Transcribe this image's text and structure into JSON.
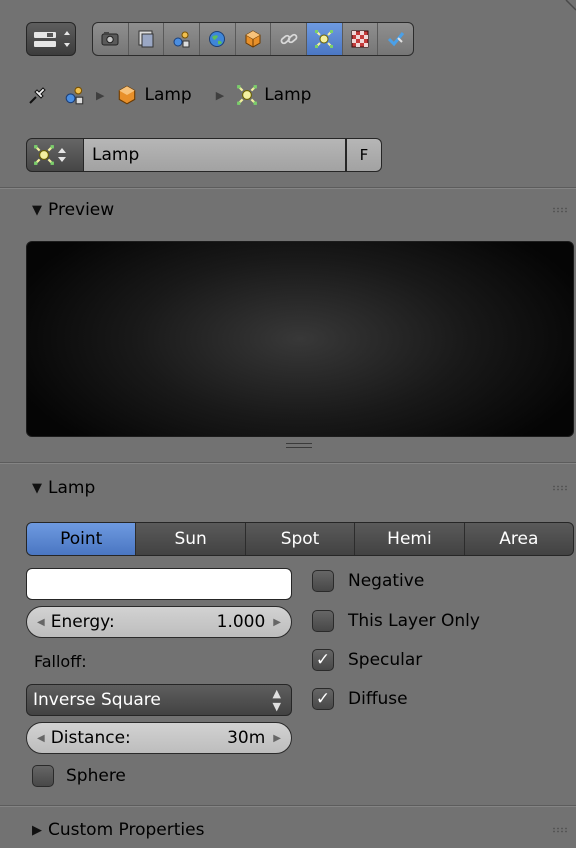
{
  "header": {
    "context_tabs": [
      {
        "icon": "render-icon",
        "active": false
      },
      {
        "icon": "render-layers-icon",
        "active": false
      },
      {
        "icon": "scene-icon",
        "active": false
      },
      {
        "icon": "world-icon",
        "active": false
      },
      {
        "icon": "object-icon",
        "active": false
      },
      {
        "icon": "constraints-icon",
        "active": false
      },
      {
        "icon": "lamp-data-icon",
        "active": true
      },
      {
        "icon": "texture-icon",
        "active": false
      },
      {
        "icon": "modifiers-icon",
        "active": false
      }
    ]
  },
  "breadcrumb": {
    "items": [
      {
        "icon": "scene-icon",
        "label": ""
      },
      {
        "icon": "object-icon",
        "label": "Lamp"
      },
      {
        "icon": "lamp-data-icon",
        "label": "Lamp"
      }
    ]
  },
  "datablock": {
    "name": "Lamp",
    "fake_user_label": "F"
  },
  "panels": {
    "preview": {
      "title": "Preview",
      "expanded": true
    },
    "lamp": {
      "title": "Lamp",
      "expanded": true
    },
    "custom_properties": {
      "title": "Custom Properties",
      "expanded": false
    }
  },
  "lamp": {
    "types": [
      "Point",
      "Sun",
      "Spot",
      "Hemi",
      "Area"
    ],
    "selected_type": "Point",
    "color": "#ffffff",
    "energy": {
      "label": "Energy:",
      "value": "1.000"
    },
    "falloff_label": "Falloff:",
    "falloff_value": "Inverse Square",
    "distance": {
      "label": "Distance:",
      "value": "30m"
    },
    "sphere": {
      "label": "Sphere",
      "checked": false
    },
    "options": [
      {
        "label": "Negative",
        "checked": false
      },
      {
        "label": "This Layer Only",
        "checked": false
      },
      {
        "label": "Specular",
        "checked": true
      },
      {
        "label": "Diffuse",
        "checked": true
      }
    ]
  },
  "colors": {
    "background": "#727272",
    "accent": "#5680c2",
    "preview_bg": "#111111"
  }
}
